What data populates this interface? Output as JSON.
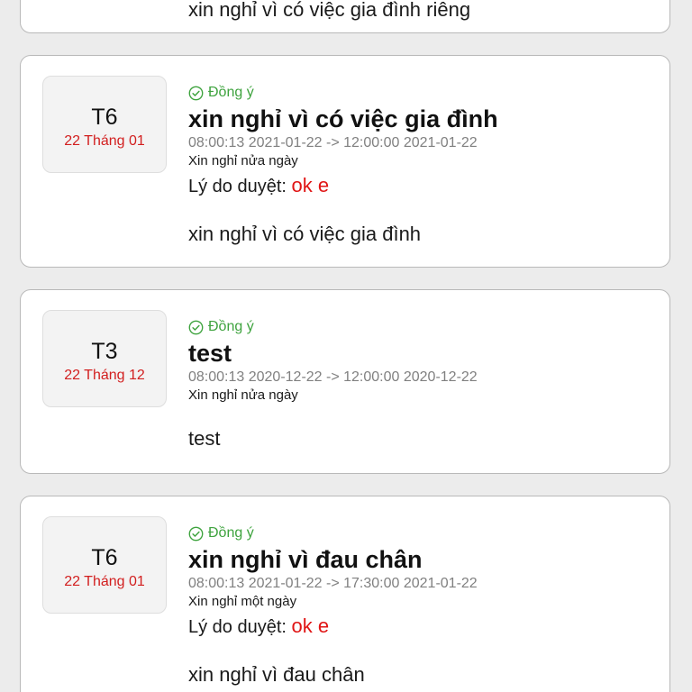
{
  "top_card": {
    "desc": "xin nghỉ vì có việc gia đình riêng"
  },
  "cards": [
    {
      "weekday": "T6",
      "daymonth": "22 Tháng 01",
      "status": "Đồng ý",
      "title": "xin nghỉ vì có việc gia đình",
      "timerange": "08:00:13 2021-01-22 -> 12:00:00 2021-01-22",
      "leave_type": "Xin nghỉ nửa ngày",
      "reason_label": "Lý do duyệt:",
      "reason_value": "ok e",
      "desc": "xin nghỉ vì có việc gia đình"
    },
    {
      "weekday": "T3",
      "daymonth": "22 Tháng 12",
      "status": "Đồng ý",
      "title": "test",
      "timerange": "08:00:13 2020-12-22 -> 12:00:00 2020-12-22",
      "leave_type": "Xin nghỉ nửa ngày",
      "desc": "test"
    },
    {
      "weekday": "T6",
      "daymonth": "22 Tháng 01",
      "status": "Đồng ý",
      "title": "xin nghỉ vì đau chân",
      "timerange": "08:00:13 2021-01-22 -> 17:30:00 2021-01-22",
      "leave_type": "Xin nghỉ một ngày",
      "reason_label": "Lý do duyệt:",
      "reason_value": "ok e",
      "desc": "xin nghỉ vì đau chân"
    }
  ],
  "colors": {
    "status_green": "#3ea33e",
    "date_red": "#d21f1f",
    "reason_red": "#e01515"
  },
  "icons": {
    "status": "check-circle-icon"
  }
}
